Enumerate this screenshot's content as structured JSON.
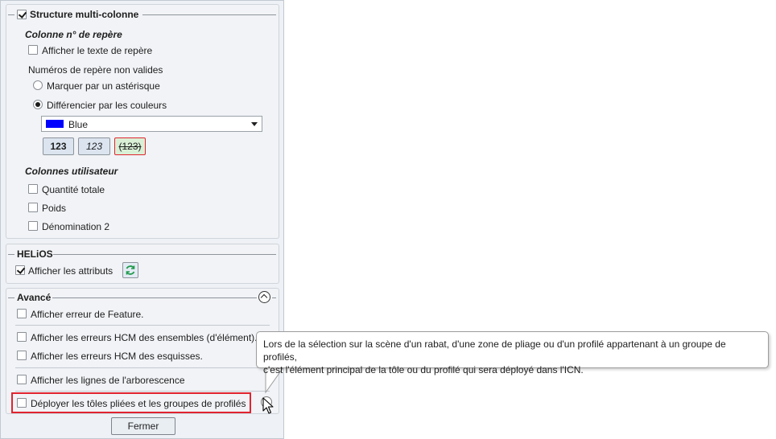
{
  "structure": {
    "title": "Structure multi-colonne",
    "colonne_heading": "Colonne n° de repère",
    "afficher_texte": "Afficher le texte de repère",
    "numeros_label": "Numéros de repère non valides",
    "radio_asterisque": "Marquer par un astérisque",
    "radio_couleurs": "Différencier par les couleurs",
    "color_select": {
      "value": "Blue",
      "swatch": "#0000ff"
    },
    "style_buttons": [
      "123",
      "123",
      "(123)"
    ],
    "colonnes_utilisateur": "Colonnes utilisateur",
    "user_columns": [
      "Quantité totale",
      "Poids",
      "Dénomination 2"
    ]
  },
  "helios": {
    "title": "HELiOS",
    "afficher_attributs": "Afficher les attributs"
  },
  "avance": {
    "title": "Avancé",
    "items": [
      "Afficher erreur de Feature.",
      "Afficher les erreurs HCM des ensembles (d'élément).",
      "Afficher les erreurs HCM des esquisses.",
      "Afficher les lignes de l'arborescence",
      "Déployer les tôles pliées et les groupes de profilés"
    ]
  },
  "fermer_label": "Fermer",
  "tooltip": {
    "line1": "Lors de la sélection sur la scène d'un rabat, d'une zone de pliage ou d'un profilé appartenant à un groupe de profilés,",
    "line2": "c'est l'élément principal de la tôle ou du profilé qui sera déployé dans l'ICN."
  },
  "colors": {
    "highlight": "#e0242f",
    "panel_bg": "#eef1f5",
    "strike_button_bg": "#d9f0d6"
  }
}
